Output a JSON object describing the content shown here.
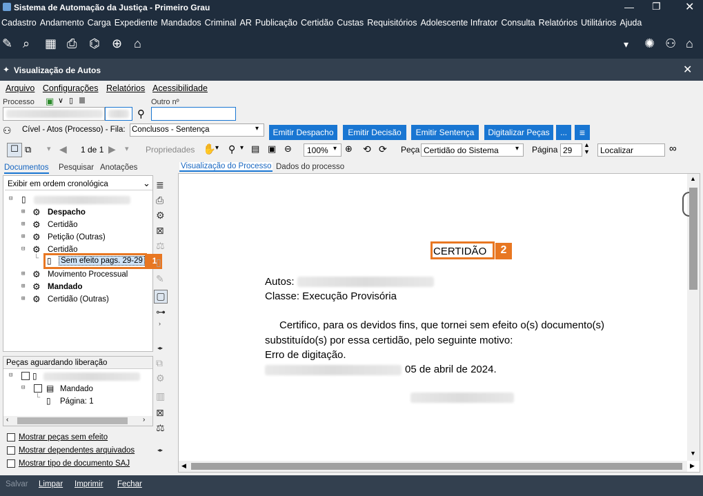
{
  "window_title": "Sistema de Automação da Justiça - Primeiro Grau",
  "main_menu": [
    "Cadastro",
    "Andamento",
    "Carga",
    "Expediente",
    "Mandados",
    "Criminal",
    "AR",
    "Publicação",
    "Certidão",
    "Custas",
    "Requisitórios",
    "Adolescente Infrator",
    "Consulta",
    "Relatórios",
    "Utilitários",
    "Ajuda"
  ],
  "subwindow_title": "Visualização de Autos",
  "sub_menu": [
    "Arquivo",
    "Configurações",
    "Relatórios",
    "Acessibilidade"
  ],
  "processo_label": "Processo",
  "outro_label": "Outro nº",
  "fila_label": "Cível - Atos (Processo) - Fila:",
  "fila_value": "Conclusos - Sentença",
  "buttons": {
    "emitir_despacho": "Emitir Despacho",
    "emitir_decisao": "Emitir Decisão",
    "emitir_sentenca": "Emitir Sentença",
    "digitalizar": "Digitalizar Peças",
    "more": "..."
  },
  "toolbar": {
    "page_counter": "1 de 1",
    "propriedades": "Propriedades",
    "zoom": "100%",
    "peca_label": "Peça",
    "peca_value": "Certidão do Sistema",
    "pagina_label": "Página",
    "pagina_value": "29",
    "localizar": "Localizar"
  },
  "left_tabs": [
    "Documentos",
    "Pesquisar",
    "Anotações"
  ],
  "order_select": "Exibir em ordem cronológica",
  "tree": [
    {
      "label": "Despacho",
      "bold": true
    },
    {
      "label": "Certidão",
      "bold": false
    },
    {
      "label": "Petição (Outras)",
      "bold": false
    },
    {
      "label": "Certidão",
      "bold": false
    },
    {
      "label": "Sem efeito pags. 29-29",
      "bold": false
    },
    {
      "label": "Movimento Processual",
      "bold": false
    },
    {
      "label": "Mandado",
      "bold": true
    },
    {
      "label": "Certidão (Outras)",
      "bold": false
    }
  ],
  "pending_title": "Peças aguardando liberação",
  "pending_tree": [
    "Mandado",
    "Página: 1"
  ],
  "checkboxes": [
    "Mostrar peças sem efeito",
    "Mostrar dependentes arquivados",
    "Mostrar tipo de documento SAJ"
  ],
  "right_tabs": [
    "Visualização do Processo",
    "Dados do processo"
  ],
  "document": {
    "heading": "CERTIDÃO",
    "autos_label": "Autos:",
    "classe": "Classe: Execução Provisória",
    "line1": "Certifico, para os devidos fins, que tornei sem efeito o(s) documento(s)",
    "line2": "substituído(s) por essa certidão, pelo seguinte motivo:",
    "line3": "Erro de digitação.",
    "date": "05 de abril de 2024."
  },
  "annotations": {
    "badge1": "1",
    "badge2": "2"
  },
  "status": [
    "Salvar",
    "Limpar",
    "Imprimir",
    "Fechar"
  ],
  "colors": {
    "titlebar": "#1f2d3d",
    "accent": "#1976d2",
    "highlight": "#e87722"
  }
}
